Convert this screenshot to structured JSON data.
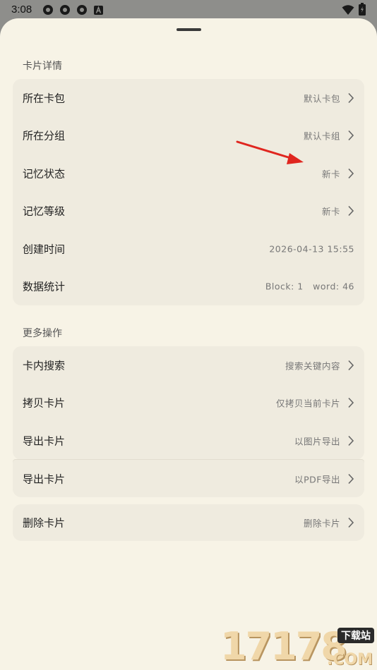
{
  "status_bar": {
    "time": "3:08",
    "icons": [
      "settings-gear-icon",
      "settings-gear-icon",
      "settings-gear-icon",
      "accessibility-a-icon",
      "wifi-icon",
      "battery-icon"
    ]
  },
  "sections": {
    "details": {
      "title": "卡片详情",
      "rows": [
        {
          "label": "所在卡包",
          "value": "默认卡包"
        },
        {
          "label": "所在分组",
          "value": "默认卡组"
        },
        {
          "label": "记忆状态",
          "value": "新卡"
        },
        {
          "label": "记忆等级",
          "value": "新卡"
        },
        {
          "label": "创建时间",
          "value": "2026-04-13 15:55"
        },
        {
          "label": "数据统计",
          "value": "Block: 1   word: 46"
        }
      ]
    },
    "actions": {
      "title": "更多操作",
      "rows": [
        {
          "label": "卡内搜索",
          "value": "搜索关键内容"
        },
        {
          "label": "拷贝卡片",
          "value": "仅拷贝当前卡片"
        },
        {
          "label": "导出卡片",
          "value": "以图片导出"
        }
      ]
    },
    "export_pdf": {
      "label": "导出卡片",
      "value": "以PDF导出"
    },
    "delete": {
      "label": "删除卡片",
      "value": "删除卡片"
    }
  },
  "watermark": {
    "digits": "17178",
    "badge": "下载站",
    "suffix": ".COM"
  },
  "colors": {
    "sheet_bg": "#f7f3e6",
    "card_bg": "#efebdf",
    "scrim": "#8e8e8b",
    "annotation_arrow": "#e0261f"
  }
}
